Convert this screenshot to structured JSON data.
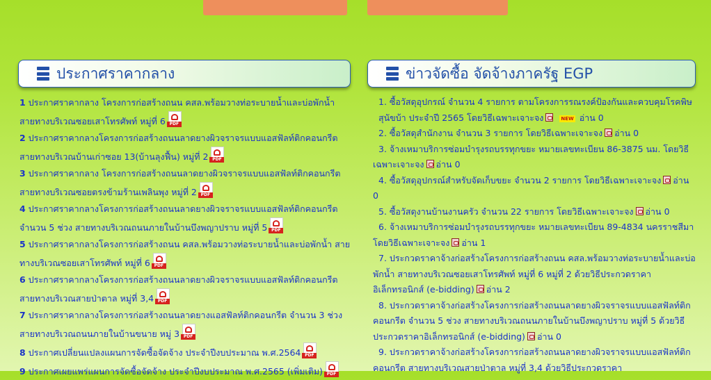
{
  "left_panel": {
    "title": "ประกาศราคากลาง",
    "items": [
      {
        "num": "1",
        "text": "ประกาศราคากลาง โครงการก่อสร้างถนน คสล.พร้อมวางท่อระบายน้ำและบ่อพักน้ำ สายทางบริเวณซอยเสาโทรศัพท์ หมู่ที่ 6"
      },
      {
        "num": "2",
        "text": "ประกาศราคากลางโครงการก่อสร้างถนนลาดยางผิวจราจรแบบแอสฟัลท์ติกคอนกรีต สายทางบริเวณบ้านเก่าซอย 13(บ้านลุงฟื้น) หมู่ที่ 2"
      },
      {
        "num": "3",
        "text": "ประกาศราคากลาง โครงการก่อสร้างถนนลาดยางผิวจราจรแบบแอสฟัลท์ติกคอนกรีต สายทางบริเวณซอยตรงข้ามร้านเพลินพุง หมู่ที่ 2"
      },
      {
        "num": "4",
        "text": "ประกาศราคากลางโครงการก่อสร้างถนนลาดยางผิวจราจรแบบแอสฟัลท์ติกคอนกรีต จำนวน 5 ช่วง สายทางบริเวณถนนภายในบ้านบึงพญาปราบ หมู่ที่ 5"
      },
      {
        "num": "5",
        "text": "ประกาศราคากลางโครงการก่อสร้างถนน คสล.พร้อมวางท่อระบายน้ำและบ่อพักน้ำ สายทางบริเวณซอยเสาโทรศัพท์ หมู่ที่ 6"
      },
      {
        "num": "6",
        "text": "ประกาศราคากลางโครงการก่อสร้างถนนลาดยางผิวจราจรแบบแอสฟัลท์ติกคอนกรีต สายทางบริเวณสายป่าตาล หมู่ที่ 3,4"
      },
      {
        "num": "7",
        "text": "ประกาศราคากลางโครงการก่อสร้างถนนลาดยางแอสฟัลท์ติกคอนกรีต จำนวน 3 ช่วง สายทางบริเวณถนนภายในบ้านขนาย หมู่ 3"
      },
      {
        "num": "8",
        "text": "ประกาศเปลี่ยนแปลงแผนการจัดซื้อจัดจ้าง ประจำปีงบประมาณ พ.ศ.2564"
      },
      {
        "num": "9",
        "text": "ประกาศเผยแพร่แผนการจัดซื้อจัดจ้าง ประจำปีงบประมาณ พ.ศ.2565 (เพิ่มเติม)"
      }
    ],
    "pdf_label": "PDF"
  },
  "right_panel": {
    "title": "ข่าวจัดซื้อ จัดจ้างภาครัฐ EGP",
    "items": [
      {
        "text": "1.  ซื้อวัสดุอุปกรณ์ จำนวน 4 รายการ ตามโครงการรณรงค์ป้องกันและควบคุมโรคพิษสุนัขบ้า ประจำปี 2565 โดยวิธีเฉพาะเจาะจง",
        "new": "NEW",
        "read": "อ่าน 0"
      },
      {
        "text": "2.  ซื้อวัสดุสำนักงาน จำนวน 3 รายการ โดยวิธีเฉพาะเจาะจง",
        "read": "อ่าน 0"
      },
      {
        "text": "3.  จ้างเหมาบริการซ่อมบำรุงรถบรรทุกขยะ หมายเลขทะเบียน 86-3875 นม. โดยวิธีเฉพาะเจาะจง",
        "read": "อ่าน 0"
      },
      {
        "text": "4.  ซื้อวัสดุอุปกรณ์สำหรับจัดเก็บขยะ จำนวน 2 รายการ โดยวิธีเฉพาะเจาะจง",
        "read": "อ่าน 0"
      },
      {
        "text": "5.  ซื้อวัสดุงานบ้านงานครัว จำนวน 22 รายการ โดยวิธีเฉพาะเจาะจง",
        "read": "อ่าน 0"
      },
      {
        "text": "6.  จ้างเหมาบริการซ่อมบำรุงรถบรรทุกขยะ หมายเลขทะเบียน 89-4834 นครราชสีมา โดยวิธีเฉพาะเจาะจง",
        "read": "อ่าน 1"
      },
      {
        "text": "7.  ประกวดราคาจ้างก่อสร้างโครงการก่อสร้างถนน คสล.พร้อมวางท่อระบายน้ำและบ่อพักน้ำ สายทางบริเวณซอยเสาโทรศัพท์ หมู่ที่ 6 หมู่ที่ 2 ด้วยวิธีประกวดราคาอิเล็กทรอนิกส์ (e-bidding)",
        "read": "อ่าน 2"
      },
      {
        "text": "8.  ประกวดราคาจ้างก่อสร้างโครงการก่อสร้างถนนลาดยางผิวจราจรแบบแอสฟัลท์ติกคอนกรีต จำนวน 5 ช่วง สายทางบริเวณถนนภายในบ้านบึงพญาปราบ หมู่ที่ 5 ด้วยวิธีประกวดราคาอิเล็กทรอนิกส์ (e-bidding)",
        "read": "อ่าน 0"
      },
      {
        "text": "9.  ประกวดราคาจ้างก่อสร้างโครงการก่อสร้างถนนลาดยางผิวจราจรแบบแอสฟัลท์ติกคอนกรีต สายทางบริเวณสายป่าตาล หมู่ที่ 3,4 ด้วยวิธีประกวดราคา",
        "read": ""
      }
    ]
  },
  "colors": {
    "accent_blue": "#2350a8",
    "link_blue": "#1a33c8",
    "top_button": "#ee8f5c",
    "pdf_red": "#d6231e"
  },
  "icons": {
    "header_icon": "list-icon",
    "pdf_icon": "pdf-icon",
    "doc_icon": "pdf-document-icon",
    "new_badge": "new-badge"
  }
}
